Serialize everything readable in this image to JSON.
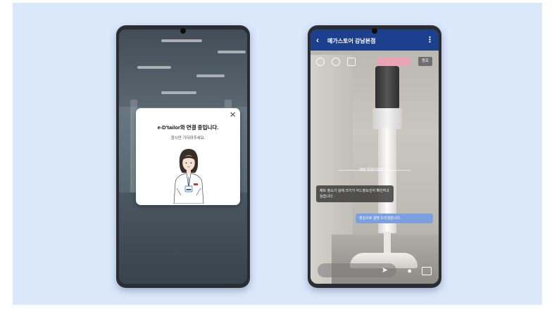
{
  "left_phone": {
    "dialog": {
      "title": "e-D'tailor와 연결 중입니다.",
      "subtitle": "잠시만 기다려주세요.",
      "close_icon": "×"
    }
  },
  "right_phone": {
    "header": {
      "back_icon": "‹",
      "title": "메가스토어 강남본점",
      "more_icon": "⋮"
    },
    "record_label": "",
    "end_label": "종료",
    "divider_label": "매장 연결되었습니다",
    "incoming": {
      "sender": "",
      "text": "제트 청소기 실제 크기가 어느정도인지 확인하고 싶습니다."
    },
    "outgoing": {
      "time": "",
      "text": "영상으로 설명 드리겠습니다."
    },
    "icons": [
      "rotate-icon",
      "flip-icon",
      "camera-icon",
      "send-icon",
      "mic-icon",
      "chat-icon"
    ]
  },
  "colors": {
    "background": "#dbe7fb",
    "header": "#1c3f8e",
    "outgoing_bubble": "#7ca0df"
  }
}
